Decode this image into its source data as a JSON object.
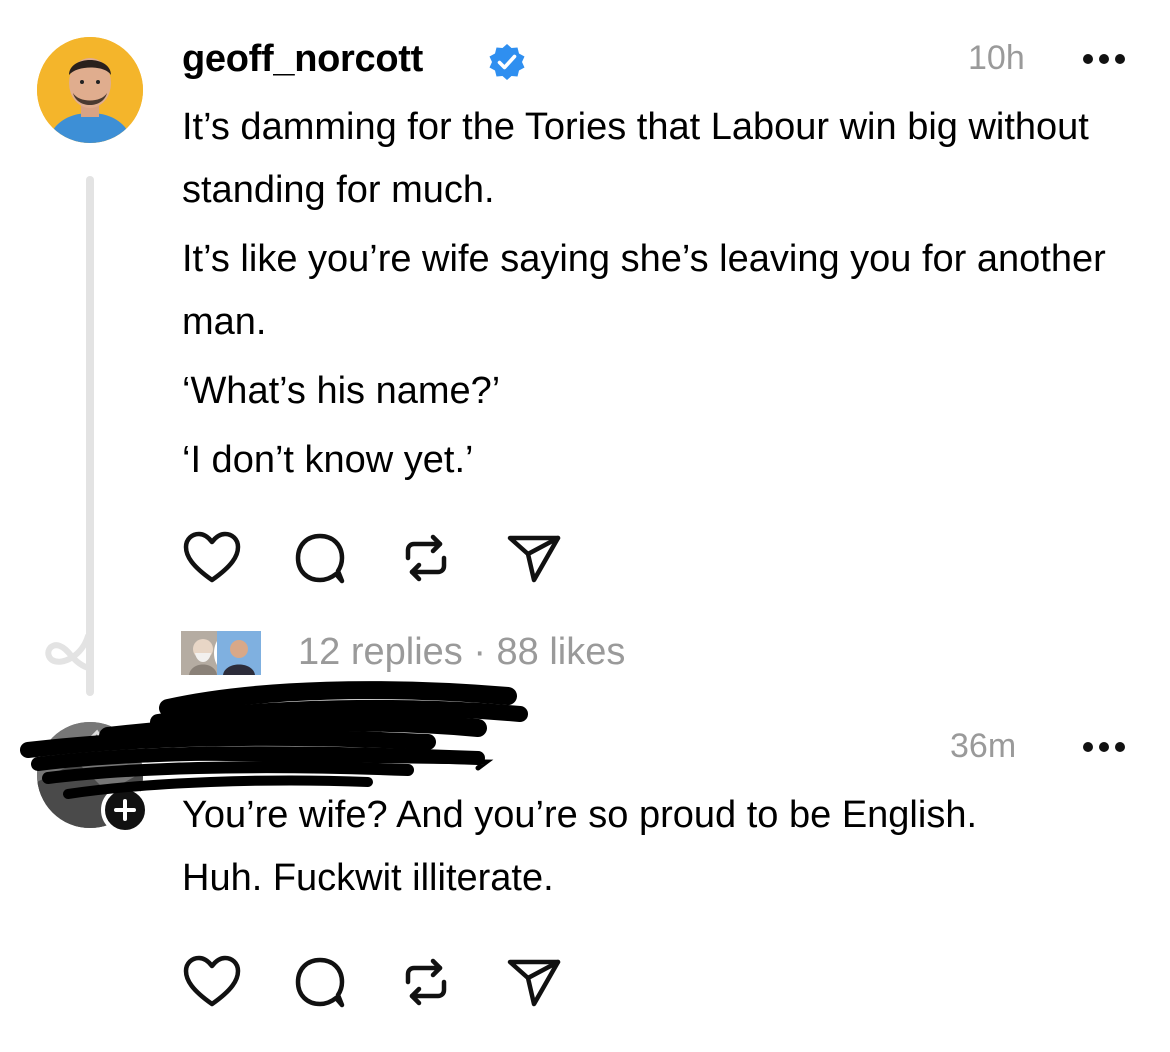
{
  "post": {
    "username": "geoff_norcott",
    "verified": true,
    "time": "10h",
    "lines": [
      "It’s damming for the Tories that Labour win big without standing for much.",
      "It’s like you’re wife saying she’s leaving you for another man.",
      "‘What’s his name?’",
      "‘I don’t know yet.’"
    ],
    "stats": "12 replies · 88 likes"
  },
  "reply": {
    "username": "",
    "time": "36m",
    "text": "You’re wife?  And you’re so proud to be English. Huh. Fuckwit illiterate."
  },
  "icons": {
    "actions": [
      "heart-icon",
      "comment-icon",
      "repost-icon",
      "share-icon"
    ],
    "more": "more-icon",
    "verified": "verified-badge-icon"
  },
  "colors": {
    "verified": "#2f8ff0",
    "secondary_text": "#9a9a9a",
    "thread_line": "#e3e3e3",
    "avatar_bg": "#f4b52b"
  }
}
